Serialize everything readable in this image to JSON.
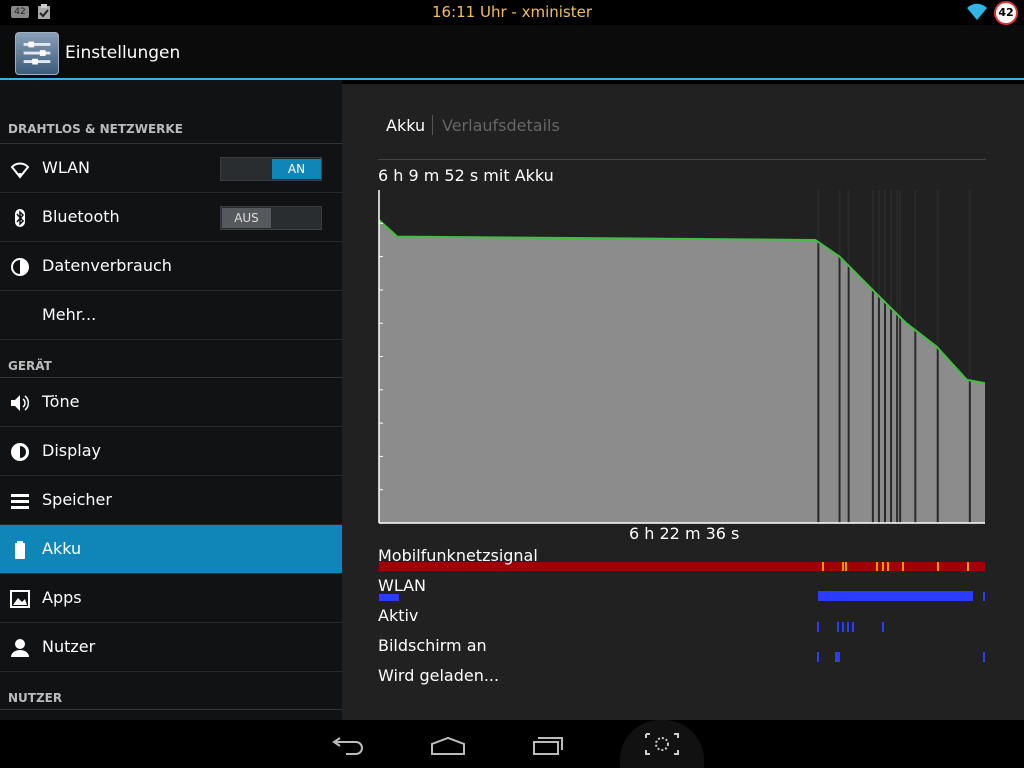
{
  "status_bar": {
    "notification_badge": "42",
    "time": "16:11 Uhr - xminister",
    "battery_level": "42",
    "icons": [
      "notification-count-icon",
      "clipboard-check-icon",
      "wifi-icon",
      "battery-ring-icon"
    ]
  },
  "action_bar": {
    "title": "Einstellungen",
    "icon": "settings-sliders-icon"
  },
  "sidebar": {
    "sections": [
      {
        "label": "DRAHTLOS & NETZWERKE"
      },
      {
        "label": "GERÄT"
      },
      {
        "label": "NUTZER"
      }
    ],
    "items": [
      {
        "label": "WLAN",
        "icon": "wifi-icon",
        "toggle": "AN"
      },
      {
        "label": "Bluetooth",
        "icon": "bluetooth-icon",
        "toggle": "AUS"
      },
      {
        "label": "Datenverbrauch",
        "icon": "data-usage-icon"
      },
      {
        "label": "Mehr...",
        "icon": ""
      },
      {
        "label": "Töne",
        "icon": "speaker-icon"
      },
      {
        "label": "Display",
        "icon": "brightness-icon"
      },
      {
        "label": "Speicher",
        "icon": "storage-icon"
      },
      {
        "label": "Akku",
        "icon": "battery-icon",
        "selected": true
      },
      {
        "label": "Apps",
        "icon": "apps-icon"
      },
      {
        "label": "Nutzer",
        "icon": "user-icon"
      }
    ]
  },
  "main": {
    "tabs": [
      {
        "label": "Akku",
        "active": true
      },
      {
        "label": "Verlaufsdetails",
        "active": false
      }
    ],
    "chart_title": "6 h 9 m 52 s mit Akku",
    "x_label": "6 h 22 m 36 s",
    "signals": [
      {
        "label": "Mobilfunknetzsignal",
        "color": "#a00000"
      },
      {
        "label": "WLAN",
        "color": "#2a3cff"
      },
      {
        "label": "Aktiv",
        "color": "#2a3cff"
      },
      {
        "label": "Bildschirm an",
        "color": "#2a3cff"
      },
      {
        "label": "Wird geladen...",
        "color": "#2a3cff"
      }
    ]
  },
  "chart_data": {
    "type": "area",
    "title": "6 h 9 m 52 s mit Akku",
    "xlabel": "6 h 22 m 36 s",
    "ylabel": "",
    "xlim": [
      0,
      1
    ],
    "ylim": [
      0,
      100
    ],
    "x": [
      0.0,
      0.03,
      0.72,
      0.76,
      0.82,
      0.87,
      0.92,
      0.97,
      1.0
    ],
    "series": [
      {
        "values": [
          91,
          86,
          85,
          80,
          69,
          60,
          53,
          43,
          42
        ]
      }
    ],
    "grid": false,
    "fill_color": "#8c8c8c",
    "line_color": "#3fbf3f"
  },
  "navigation_bar": {
    "buttons": [
      "back-icon",
      "home-icon",
      "recent-apps-icon",
      "screenshot-icon"
    ]
  }
}
